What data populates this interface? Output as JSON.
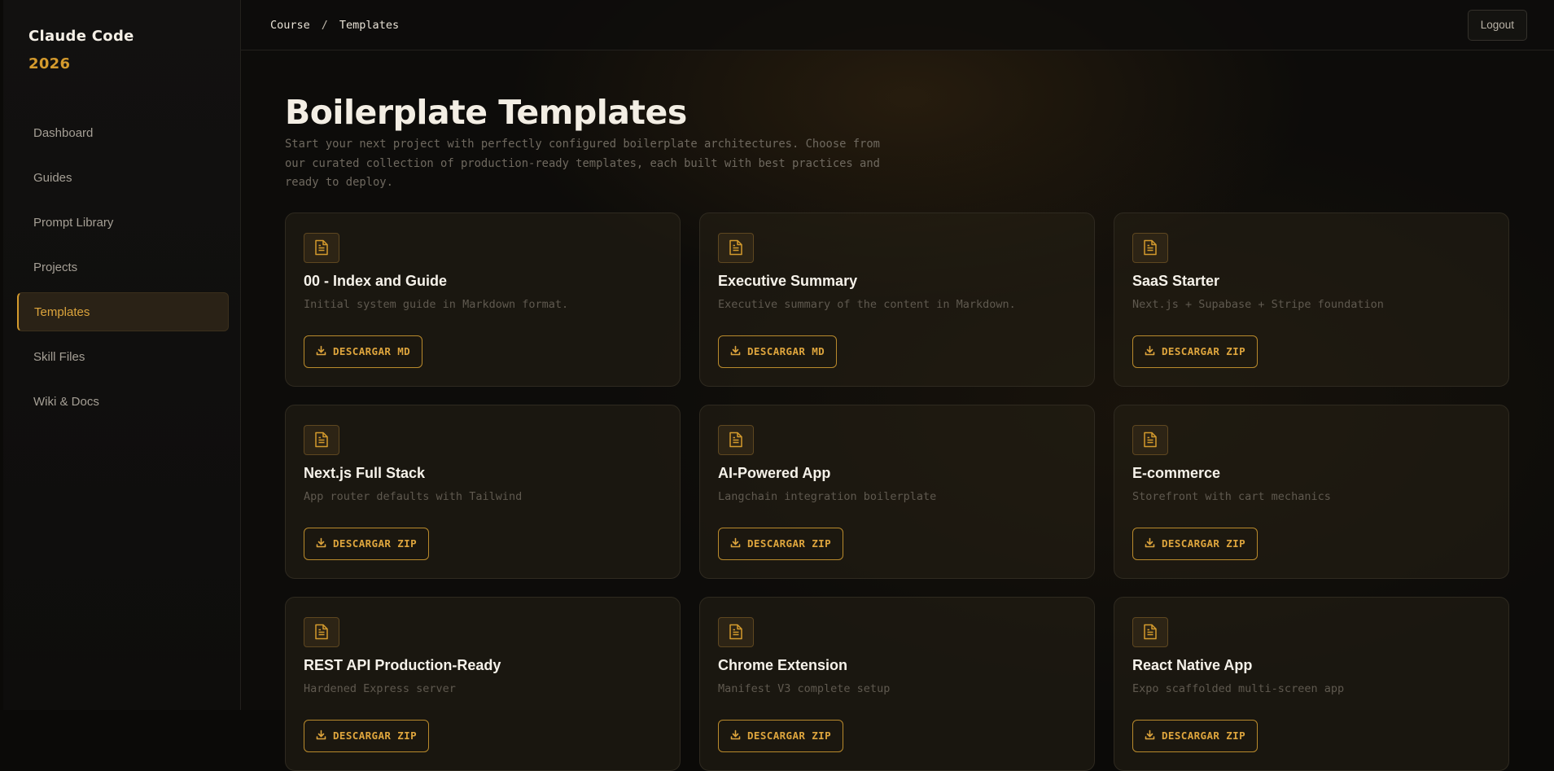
{
  "brand": {
    "line1": "Claude Code",
    "line2": "2026"
  },
  "sidebar": {
    "items": [
      {
        "label": "Dashboard",
        "active": false
      },
      {
        "label": "Guides",
        "active": false
      },
      {
        "label": "Prompt Library",
        "active": false
      },
      {
        "label": "Projects",
        "active": false
      },
      {
        "label": "Templates",
        "active": true
      },
      {
        "label": "Skill Files",
        "active": false
      },
      {
        "label": "Wiki & Docs",
        "active": false
      }
    ]
  },
  "header": {
    "breadcrumb": [
      "Course",
      "Templates"
    ],
    "separator": "/",
    "logout_label": "Logout"
  },
  "page": {
    "title": "Boilerplate Templates",
    "description": "Start your next project with perfectly configured boilerplate architectures. Choose from our curated collection of production-ready templates, each built with best practices and ready to deploy."
  },
  "cards": [
    {
      "title": "00 - Index and Guide",
      "desc": "Initial system guide in Markdown format.",
      "button": "DESCARGAR MD"
    },
    {
      "title": "Executive Summary",
      "desc": "Executive summary of the content in Markdown.",
      "button": "DESCARGAR MD"
    },
    {
      "title": "SaaS Starter",
      "desc": "Next.js + Supabase + Stripe foundation",
      "button": "DESCARGAR ZIP"
    },
    {
      "title": "Next.js Full Stack",
      "desc": "App router defaults with Tailwind",
      "button": "DESCARGAR ZIP"
    },
    {
      "title": "AI-Powered App",
      "desc": "Langchain integration boilerplate",
      "button": "DESCARGAR ZIP"
    },
    {
      "title": "E-commerce",
      "desc": "Storefront with cart mechanics",
      "button": "DESCARGAR ZIP"
    },
    {
      "title": "REST API Production-Ready",
      "desc": "Hardened Express server",
      "button": "DESCARGAR ZIP"
    },
    {
      "title": "Chrome Extension",
      "desc": "Manifest V3 complete setup",
      "button": "DESCARGAR ZIP"
    },
    {
      "title": "React Native App",
      "desc": "Expo scaffolded multi-screen app",
      "button": "DESCARGAR ZIP"
    }
  ],
  "icons": {
    "card_icon": "document-icon",
    "button_icon": "download-icon"
  },
  "colors": {
    "accent": "#d49a2d",
    "background": "#0c0b09",
    "card_border": "#2f2a20"
  }
}
